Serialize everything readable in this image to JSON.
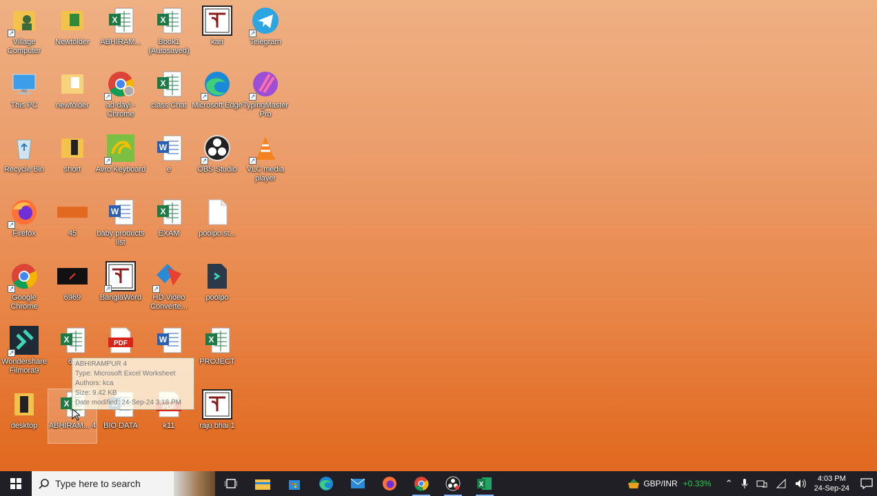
{
  "desktop_icons": [
    {
      "label": "Village Computer",
      "icon": "folder-user-icon"
    },
    {
      "label": "Newfolder",
      "icon": "folder-icon"
    },
    {
      "label": "ABHIRAM...",
      "icon": "excel-file-icon"
    },
    {
      "label": "Book1 (Autosaved)",
      "icon": "excel-file-icon"
    },
    {
      "label": "kari",
      "icon": "bangla-word-icon"
    },
    {
      "label": "Telegram",
      "icon": "telegram-icon"
    },
    {
      "label": "This PC",
      "icon": "computer-icon"
    },
    {
      "label": "newfolder",
      "icon": "folder-icon"
    },
    {
      "label": "ad-dayi - Chrome",
      "icon": "chrome-profile-icon"
    },
    {
      "label": "class Chat",
      "icon": "excel-file-icon"
    },
    {
      "label": "Microsoft Edge",
      "icon": "edge-icon"
    },
    {
      "label": "TypingMaster Pro",
      "icon": "typingmaster-icon"
    },
    {
      "label": "Recycle Bin",
      "icon": "recycle-bin-icon"
    },
    {
      "label": "short",
      "icon": "folder-icon"
    },
    {
      "label": "Avro Keyboard",
      "icon": "avro-keyboard-icon"
    },
    {
      "label": "e",
      "icon": "word-file-icon"
    },
    {
      "label": "OBS Studio",
      "icon": "obs-icon"
    },
    {
      "label": "VLC media player",
      "icon": "vlc-icon"
    },
    {
      "label": "Firefox",
      "icon": "firefox-icon"
    },
    {
      "label": "45",
      "icon": "orange-file-icon"
    },
    {
      "label": "baby products list",
      "icon": "word-file-icon"
    },
    {
      "label": "EXAM",
      "icon": "excel-file-icon"
    },
    {
      "label": "poolpo.st...",
      "icon": "blank-file-icon"
    },
    {
      "label": "Google Chrome",
      "icon": "chrome-icon"
    },
    {
      "label": "6969",
      "icon": "video-thumb-icon"
    },
    {
      "label": "BanglaWord",
      "icon": "bangla-word-icon"
    },
    {
      "label": "HD Video Converte...",
      "icon": "hd-video-converter-icon"
    },
    {
      "label": "poolpo",
      "icon": "filmora-file-icon"
    },
    {
      "label": "Wondershare Filmora9",
      "icon": "filmora-icon"
    },
    {
      "label": "66",
      "icon": "excel-file-icon"
    },
    {
      "label": "",
      "icon": "pdf-file-icon"
    },
    {
      "label": "",
      "icon": "word-file-icon"
    },
    {
      "label": "PROJECT",
      "icon": "excel-file-icon"
    },
    {
      "label": "desktop",
      "icon": "folder-dark-icon"
    },
    {
      "label": "ABHIRAM... 4",
      "icon": "excel-file-icon"
    },
    {
      "label": "BIO DATA",
      "icon": "word-file-icon"
    },
    {
      "label": "k11",
      "icon": "pdf-file-icon"
    },
    {
      "label": "raju bhai 1",
      "icon": "bangla-word-icon"
    }
  ],
  "tooltip": {
    "name": "ABHIRAMPUR 4",
    "type": "Type: Microsoft Excel Worksheet",
    "authors": "Authors: kca",
    "size": "Size: 9.42 KB",
    "modified": "Date modified: 24-Sep-24 3:18 PM"
  },
  "taskbar": {
    "search_placeholder": "Type here to search",
    "apps": [
      "task-view-icon",
      "file-explorer-icon",
      "store-icon",
      "edge-icon",
      "mail-icon",
      "firefox-icon",
      "chrome-icon",
      "obs-icon",
      "excel-icon"
    ],
    "currency": "GBP/INR",
    "change": "+0.33%",
    "time": "4:03 PM",
    "date": "24-Sep-24"
  },
  "colors": {
    "excel": "#1d7a45",
    "word": "#2b5fb4",
    "pdf": "#d9241c",
    "taskbar": "#1f1f25",
    "change_up": "#26d24a"
  }
}
